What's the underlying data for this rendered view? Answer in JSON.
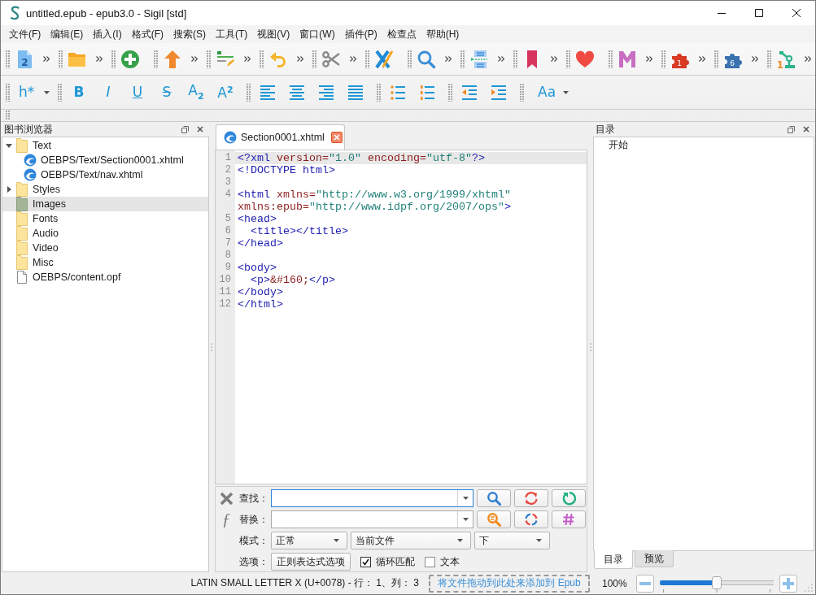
{
  "window": {
    "title": "untitled.epub - epub3.0 - Sigil [std]"
  },
  "menu": [
    "文件(F)",
    "编辑(E)",
    "插入(I)",
    "格式(F)",
    "搜索(S)",
    "工具(T)",
    "视图(V)",
    "窗口(W)",
    "插件(P)",
    "检查点",
    "帮助(H)"
  ],
  "main_toolbar": {
    "groups": [
      {
        "items": [
          {
            "kind": "new-file",
            "badge": "2"
          }
        ],
        "overflow": true
      },
      {
        "items": [
          {
            "kind": "open-folder"
          }
        ],
        "overflow": true
      },
      {
        "items": [
          {
            "kind": "add"
          }
        ],
        "overflow": false
      },
      {
        "items": [
          {
            "kind": "up-arrow"
          }
        ],
        "overflow": true
      },
      {
        "items": [
          {
            "kind": "list-pencil"
          }
        ],
        "overflow": true
      },
      {
        "items": [
          {
            "kind": "undo"
          }
        ],
        "overflow": true
      },
      {
        "items": [
          {
            "kind": "scissors"
          }
        ],
        "overflow": true
      },
      {
        "items": [
          {
            "kind": "x-pencil"
          }
        ],
        "overflow": false
      },
      {
        "items": [
          {
            "kind": "search"
          }
        ],
        "overflow": true
      },
      {
        "items": [
          {
            "kind": "split"
          }
        ],
        "overflow": true
      },
      {
        "items": [
          {
            "kind": "bookmark"
          }
        ],
        "overflow": true
      },
      {
        "items": [
          {
            "kind": "heart"
          }
        ],
        "overflow": false
      },
      {
        "items": [
          {
            "kind": "m-logo"
          }
        ],
        "overflow": true
      },
      {
        "items": [
          {
            "kind": "plugin",
            "badge": "1",
            "color": "#d93a24"
          }
        ],
        "overflow": true
      },
      {
        "items": [
          {
            "kind": "plugin",
            "badge": "6",
            "color": "#3b72b0"
          }
        ],
        "overflow": true
      },
      {
        "items": [
          {
            "kind": "robot-arm",
            "badge": "1"
          }
        ],
        "overflow": true
      }
    ]
  },
  "format_toolbar": {
    "groups": [
      {
        "items": [
          {
            "kind": "heading-menu",
            "label": "h*"
          }
        ]
      },
      {
        "items": [
          {
            "kind": "bold",
            "label": "B"
          },
          {
            "kind": "italic",
            "label": "I"
          },
          {
            "kind": "underline",
            "label": "U"
          },
          {
            "kind": "strike",
            "label": "S"
          },
          {
            "kind": "subscript",
            "label": "A$_{2}$"
          },
          {
            "kind": "superscript",
            "label": "A$^{2}$"
          }
        ]
      },
      {
        "items": [
          {
            "kind": "align-left"
          },
          {
            "kind": "align-center"
          },
          {
            "kind": "align-right"
          },
          {
            "kind": "justify"
          }
        ]
      },
      {
        "items": [
          {
            "kind": "bullet-list"
          },
          {
            "kind": "numbered-list"
          }
        ]
      },
      {
        "items": [
          {
            "kind": "outdent"
          },
          {
            "kind": "indent"
          }
        ]
      },
      {
        "items": [
          {
            "kind": "case-menu",
            "label": "Aa"
          }
        ]
      }
    ]
  },
  "book_browser": {
    "title": "图书浏览器",
    "items": [
      {
        "kind": "folder",
        "label": "Text",
        "expanded": true,
        "selected": false,
        "children": [
          {
            "kind": "xhtml",
            "label": "OEBPS/Text/Section0001.xhtml",
            "selected": false
          },
          {
            "kind": "xhtml",
            "label": "OEBPS/Text/nav.xhtml",
            "selected": false
          }
        ]
      },
      {
        "kind": "folder",
        "label": "Styles",
        "expanded": false,
        "selected": false
      },
      {
        "kind": "folder",
        "label": "Images",
        "selected": true
      },
      {
        "kind": "folder",
        "label": "Fonts",
        "selected": false
      },
      {
        "kind": "folder",
        "label": "Audio",
        "selected": false
      },
      {
        "kind": "folder",
        "label": "Video",
        "selected": false
      },
      {
        "kind": "folder",
        "label": "Misc",
        "selected": false
      },
      {
        "kind": "document",
        "label": "OEBPS/content.opf",
        "selected": false
      }
    ]
  },
  "editor": {
    "tabs": [
      {
        "label": "Section0001.xhtml",
        "selected": true
      }
    ],
    "lines": [
      {
        "number": "1",
        "current": true,
        "tokens": [
          {
            "kind": "tag",
            "text": "<?xml"
          },
          {
            "kind": "attr",
            "text": " version="
          },
          {
            "kind": "value",
            "text": "\"1.0\""
          },
          {
            "kind": "attr",
            "text": " encoding="
          },
          {
            "kind": "value",
            "text": "\"utf-8\""
          },
          {
            "kind": "tag",
            "text": "?>"
          }
        ]
      },
      {
        "number": "2",
        "current": false,
        "tokens": [
          {
            "kind": "tag",
            "text": "<!DOCTYPE html>"
          }
        ]
      },
      {
        "number": "3",
        "current": false
      },
      {
        "number": "4",
        "current": false,
        "tokens": [
          {
            "kind": "tag",
            "text": "<html"
          },
          {
            "kind": "attr",
            "text": " xmlns="
          },
          {
            "kind": "value",
            "text": "\"http://www.w3.org/1999/xhtml\""
          }
        ]
      },
      {
        "current": false,
        "tokens": [
          {
            "kind": "attr",
            "text": "xmlns:epub="
          },
          {
            "kind": "value",
            "text": "\"http://www.idpf.org/2007/ops\""
          },
          {
            "kind": "tag",
            "text": ">"
          }
        ]
      },
      {
        "number": "5",
        "current": false,
        "tokens": [
          {
            "kind": "tag",
            "text": "<head>"
          }
        ]
      },
      {
        "number": "6",
        "current": false,
        "tokens": [
          {
            "kind": "tag",
            "text": "  <title></title>"
          }
        ]
      },
      {
        "number": "7",
        "current": false,
        "tokens": [
          {
            "kind": "tag",
            "text": "</head>"
          }
        ]
      },
      {
        "number": "8",
        "current": false
      },
      {
        "number": "9",
        "current": false,
        "tokens": [
          {
            "kind": "tag",
            "text": "<body>"
          }
        ]
      },
      {
        "number": "10",
        "current": false,
        "tokens": [
          {
            "kind": "tag",
            "text": "  <p>"
          },
          {
            "kind": "entity",
            "text": "&#160;"
          },
          {
            "kind": "tag",
            "text": "</p>"
          }
        ]
      },
      {
        "number": "11",
        "current": false,
        "tokens": [
          {
            "kind": "tag",
            "text": "</body>"
          }
        ]
      },
      {
        "number": "12",
        "current": false,
        "tokens": [
          {
            "kind": "tag",
            "text": "</html>"
          }
        ]
      }
    ]
  },
  "find_panel": {
    "function_glyph": "ƒ",
    "find": {
      "label": "查找：",
      "focused": true,
      "buttons": [
        {
          "kind": "search"
        },
        {
          "kind": "cycle"
        },
        {
          "kind": "restart"
        }
      ]
    },
    "replace": {
      "label": "替换：",
      "focused": false,
      "buttons": [
        {
          "kind": "search-alt"
        },
        {
          "kind": "dashed-cycle"
        },
        {
          "kind": "hash"
        }
      ]
    },
    "mode": {
      "label": "模式：",
      "selects": [
        "正常",
        "当前文件",
        "下"
      ]
    },
    "options": {
      "label": "选项：",
      "button": "正则表达式选项",
      "checks": [
        {
          "label": "循环匹配",
          "checked": true
        },
        {
          "label": "文本",
          "checked": false
        }
      ]
    }
  },
  "toc_panel": {
    "title": "目录",
    "items": [
      {
        "label": "开始",
        "selected": false
      }
    ],
    "tabs": [
      {
        "label": "目录",
        "selected": true
      },
      {
        "label": "预览",
        "selected": false
      }
    ]
  },
  "status_bar": {
    "message": "LATIN SMALL LETTER X (U+0078) - 行： 1、列： 3",
    "drop_zone": "将文件拖动到此处来添加到 Epub",
    "zoom": {
      "reading": "100%",
      "level": 0.5
    }
  }
}
